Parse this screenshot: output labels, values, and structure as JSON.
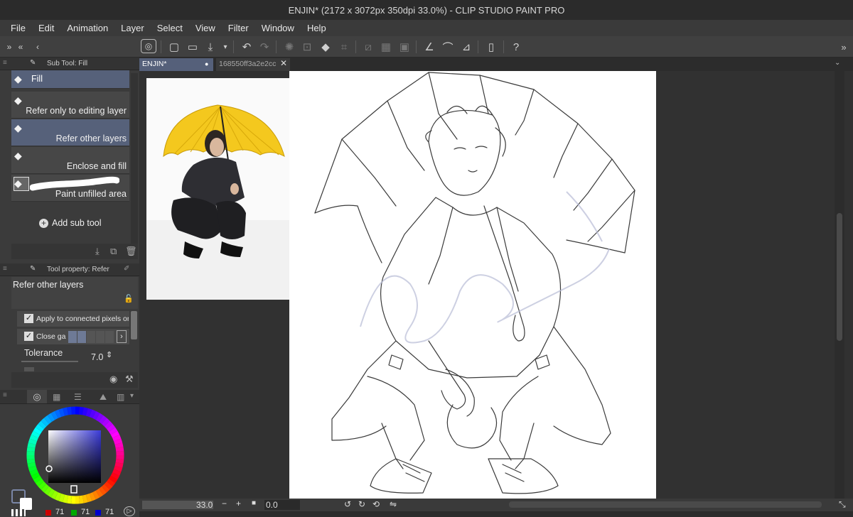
{
  "window": {
    "title": "ENJIN* (2172 x 3072px 350dpi 33.0%)  - CLIP STUDIO PAINT PRO"
  },
  "menu": [
    "File",
    "Edit",
    "Animation",
    "Layer",
    "Select",
    "View",
    "Filter",
    "Window",
    "Help"
  ],
  "subtool_panel": {
    "header": "Sub Tool: Fill",
    "items": [
      {
        "label": "Fill",
        "selected": true
      },
      {
        "label": "Refer only to editing layer",
        "selected": false
      },
      {
        "label": "Refer other layers",
        "selected": true
      },
      {
        "label": "Enclose and fill",
        "selected": false
      },
      {
        "label": "Paint unfilled area",
        "selected": false
      }
    ],
    "add_label": "Add sub tool"
  },
  "tool_property": {
    "header": "Tool property: Refer",
    "title": "Refer other layers",
    "apply_connected": "Apply to connected pixels onl",
    "close_gap": "Close gap",
    "tolerance_label": "Tolerance",
    "tolerance_value": "7.0",
    "apply_connected_checked": true,
    "close_gap_checked": true
  },
  "color": {
    "r": "71",
    "g": "71",
    "b": "71",
    "accent": "#3b3bd9"
  },
  "tabs": [
    {
      "label": "ENJIN*",
      "active": true
    },
    {
      "label": "168550ff3a2e2cc",
      "active": false
    }
  ],
  "status": {
    "zoom": "33.0",
    "rotation": "0.0"
  },
  "colors": {
    "selection": "#56617a",
    "panel": "#3b3b3b",
    "canvas_bg": "#313131"
  }
}
